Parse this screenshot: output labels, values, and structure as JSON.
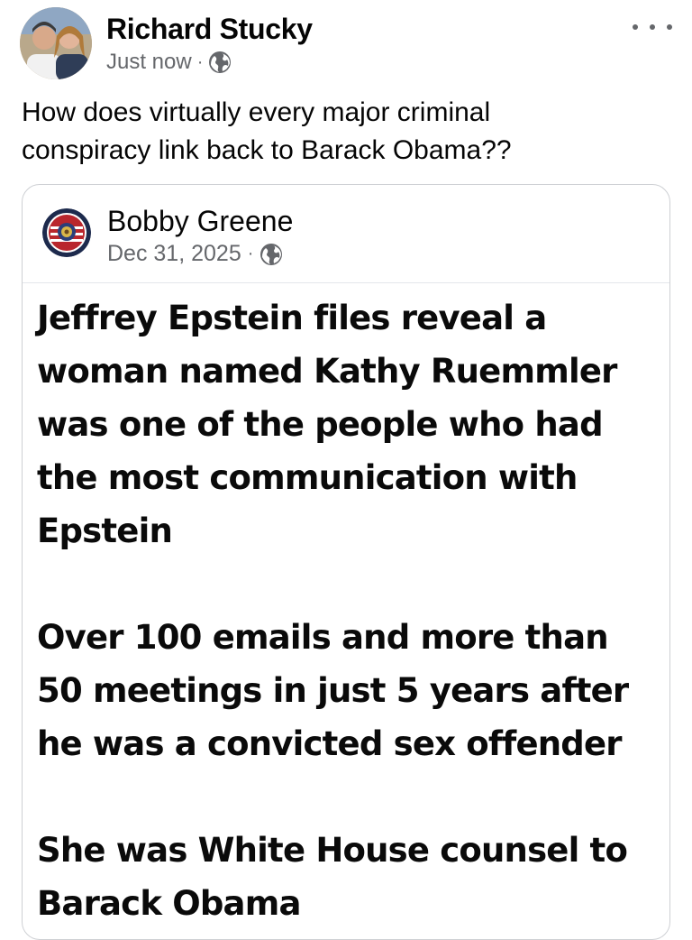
{
  "post": {
    "author": "Richard Stucky",
    "timestamp": "Just now",
    "separator": "·",
    "audience_icon": "globe-icon",
    "text": "How does virtually every major criminal\nconspiracy link back to Barack Obama??"
  },
  "shared_post": {
    "author": "Bobby Greene",
    "date": "Dec 31, 2025",
    "separator": "·",
    "audience_icon": "globe-icon",
    "image_text": [
      "Jeffrey Epstein files reveal a\nwoman named Kathy Ruemmler\nwas one of the people who had\nthe most communication with\nEpstein",
      "Over 100 emails and more than\n50 meetings in just 5 years after\nhe was a convicted sex offender",
      "She was White House counsel to\nBarack Obama"
    ]
  },
  "colors": {
    "text_primary": "#050505",
    "text_secondary": "#65676b",
    "card_border": "#ced0d4"
  }
}
